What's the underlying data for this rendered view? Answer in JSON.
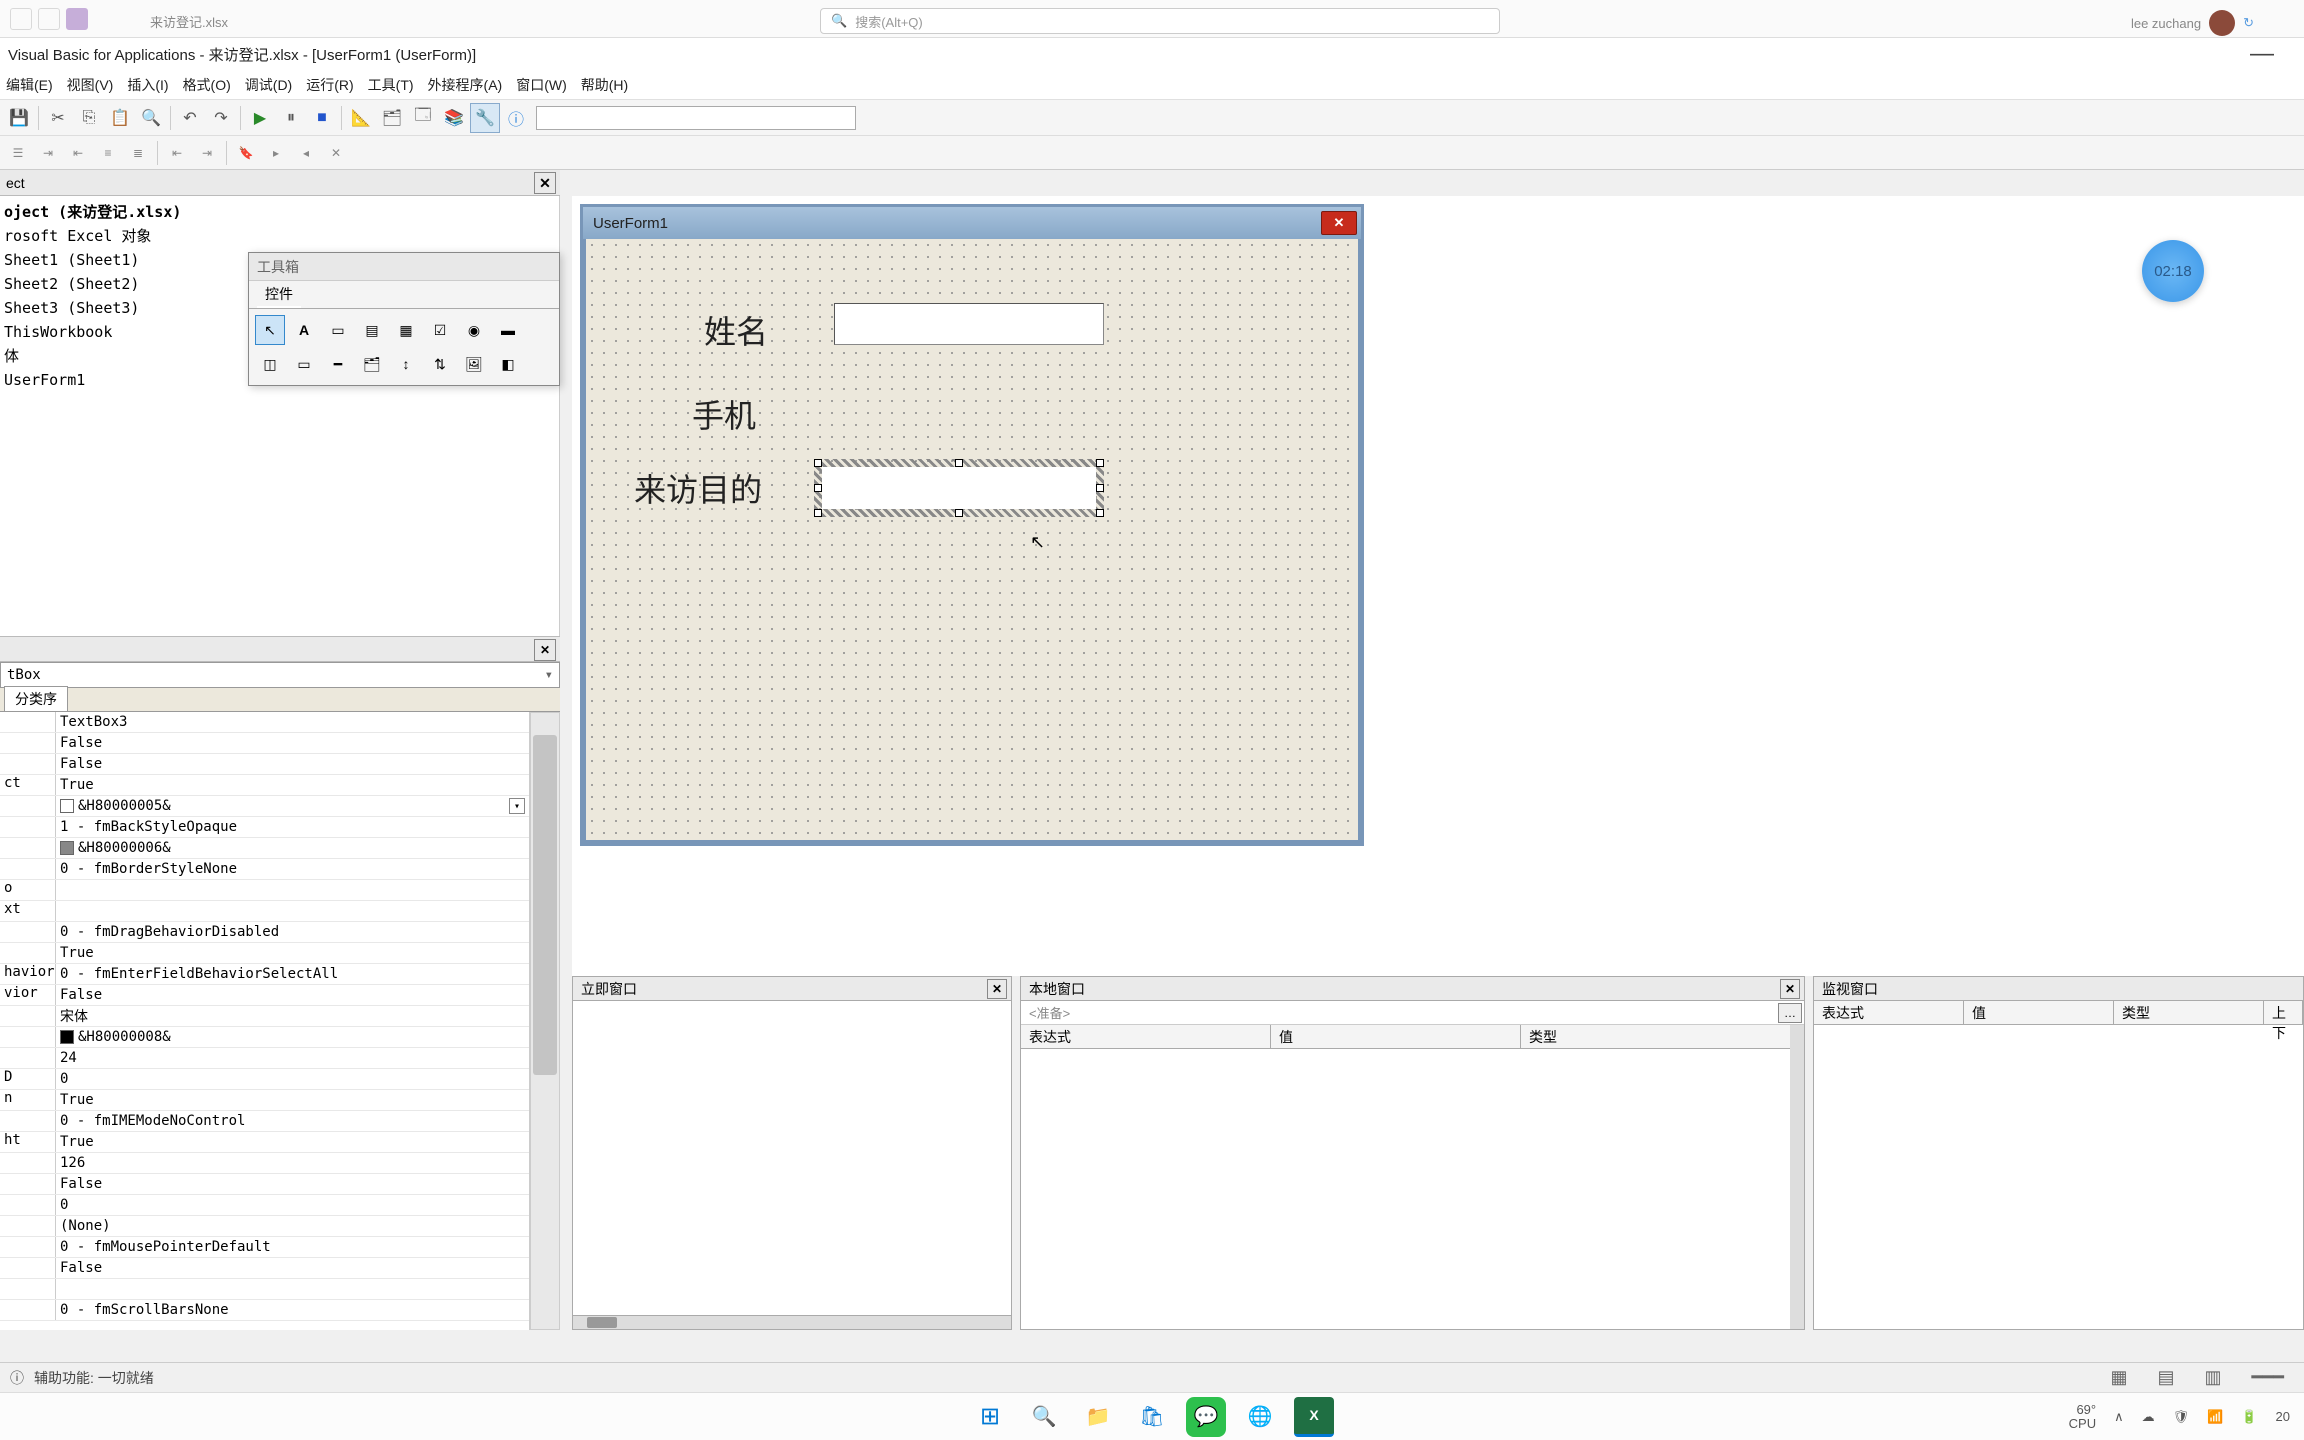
{
  "excel_top": {
    "search_placeholder": "搜索(Alt+Q)",
    "tab_name": "来访登记.xlsx",
    "user_name": "lee zuchang"
  },
  "titlebar": "Visual Basic for Applications - 来访登记.xlsx - [UserForm1 (UserForm)]",
  "menu": [
    "编辑(E)",
    "视图(V)",
    "插入(I)",
    "格式(O)",
    "调试(D)",
    "运行(R)",
    "工具(T)",
    "外接程序(A)",
    "窗口(W)",
    "帮助(H)"
  ],
  "project": {
    "header": "ect",
    "root": "oject (来访登记.xlsx)",
    "excel_objects": "rosoft Excel 对象",
    "items": [
      "Sheet1 (Sheet1)",
      "Sheet2 (Sheet2)",
      "Sheet3 (Sheet3)",
      "ThisWorkbook"
    ],
    "forms_node": "体",
    "form_item": "UserForm1"
  },
  "toolbox": {
    "title": "工具箱",
    "tab": "控件"
  },
  "properties": {
    "object": "tBox",
    "tab": "分类序",
    "rows": [
      {
        "name": "",
        "val": "TextBox3"
      },
      {
        "name": "",
        "val": "False"
      },
      {
        "name": "",
        "val": "False"
      },
      {
        "name": "ct",
        "val": "True"
      },
      {
        "name": "",
        "val": "&H80000005&",
        "swatch": "#ffffff",
        "dd": true
      },
      {
        "name": "",
        "val": "1 - fmBackStyleOpaque"
      },
      {
        "name": "",
        "val": "&H80000006&",
        "swatch": "#888888"
      },
      {
        "name": "",
        "val": "0 - fmBorderStyleNone"
      },
      {
        "name": "o",
        "val": ""
      },
      {
        "name": "xt",
        "val": ""
      },
      {
        "name": "",
        "val": "0 - fmDragBehaviorDisabled"
      },
      {
        "name": "",
        "val": "True"
      },
      {
        "name": "havior",
        "val": "0 - fmEnterFieldBehaviorSelectAll"
      },
      {
        "name": "vior",
        "val": "False"
      },
      {
        "name": "",
        "val": "宋体"
      },
      {
        "name": "",
        "val": "&H80000008&",
        "swatch": "#000000"
      },
      {
        "name": "",
        "val": "24"
      },
      {
        "name": "D",
        "val": "0"
      },
      {
        "name": "n",
        "val": "True"
      },
      {
        "name": "",
        "val": "0 - fmIMEModeNoControl"
      },
      {
        "name": "ht",
        "val": "True"
      },
      {
        "name": "",
        "val": "126"
      },
      {
        "name": "",
        "val": "False"
      },
      {
        "name": "",
        "val": "0"
      },
      {
        "name": "",
        "val": "(None)"
      },
      {
        "name": "",
        "val": "0 - fmMousePointerDefault"
      },
      {
        "name": "",
        "val": "False"
      },
      {
        "name": "",
        "val": ""
      },
      {
        "name": "",
        "val": "0 - fmScrollBarsNone"
      }
    ]
  },
  "userform": {
    "title": "UserForm1",
    "labels": {
      "name": "姓名",
      "phone": "手机",
      "purpose": "来访目的"
    }
  },
  "panels": {
    "immediate": "立即窗口",
    "locals": "本地窗口",
    "watch": "监视窗口",
    "ready": "<准备>",
    "col_expr": "表达式",
    "col_val": "值",
    "col_type": "类型",
    "col_ctx": "上下"
  },
  "statusbar": {
    "a11y": "辅助功能: 一切就绪"
  },
  "timer": "02:18",
  "system": {
    "temp": "69°",
    "cpu": "CPU",
    "ime_up": "∧",
    "time_partial": "20"
  }
}
